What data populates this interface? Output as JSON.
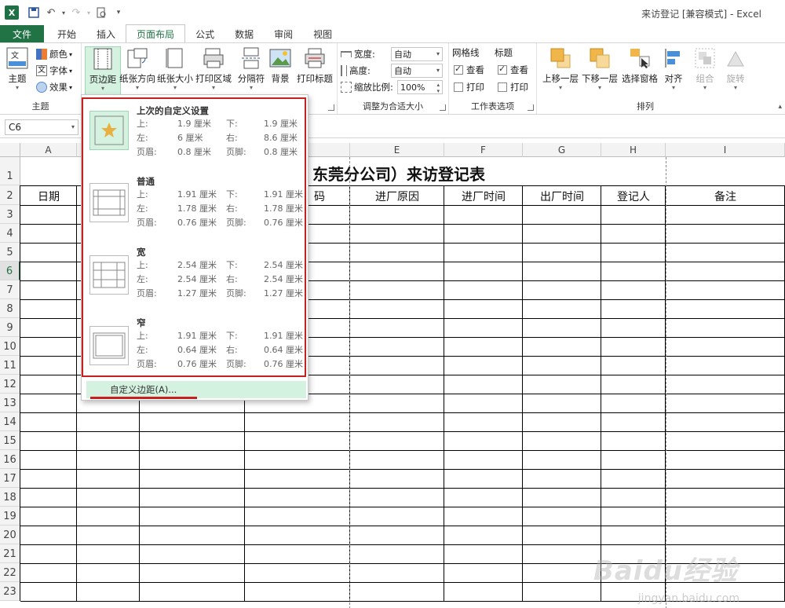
{
  "window": {
    "title": "来访登记  [兼容模式] - Excel"
  },
  "tabs": [
    {
      "label": "文件"
    },
    {
      "label": "开始"
    },
    {
      "label": "插入"
    },
    {
      "label": "页面布局"
    },
    {
      "label": "公式"
    },
    {
      "label": "数据"
    },
    {
      "label": "审阅"
    },
    {
      "label": "视图"
    }
  ],
  "ribbon": {
    "theme": {
      "main": "主题",
      "colors": "颜色",
      "fonts": "字体",
      "effects": "效果",
      "group": "主题"
    },
    "pagesetup": {
      "margins": "页边距",
      "orientation": "纸张方向",
      "size": "纸张大小",
      "print_area": "打印区域",
      "breaks": "分隔符",
      "background": "背景",
      "print_titles": "打印标题"
    },
    "scale": {
      "width_label": "宽度:",
      "width_value": "自动",
      "height_label": "高度:",
      "height_value": "自动",
      "scale_label": "缩放比例:",
      "scale_value": "100%",
      "group": "调整为合适大小"
    },
    "sheet_options": {
      "gridlines": "网格线",
      "headings": "标题",
      "view1": "查看",
      "print1": "打印",
      "view2": "查看",
      "print2": "打印",
      "group": "工作表选项"
    },
    "arrange": {
      "forward": "上移一层",
      "backward": "下移一层",
      "selection": "选择窗格",
      "align": "对齐",
      "group_btn": "组合",
      "rotate": "旋转",
      "group": "排列"
    }
  },
  "namebox": {
    "value": "C6"
  },
  "columns": [
    "A",
    "B",
    "C",
    "D",
    "E",
    "F",
    "G",
    "H",
    "I"
  ],
  "rows": [
    "1",
    "2",
    "3",
    "4",
    "5",
    "6",
    "7",
    "8",
    "9",
    "10",
    "11",
    "12",
    "13",
    "14",
    "15",
    "16",
    "17",
    "18",
    "19",
    "20",
    "21",
    "22",
    "23"
  ],
  "sheet": {
    "title_fragment": "东莞分公司）来访登记表",
    "headers": {
      "a": "日期",
      "d_tail": "码",
      "e": "进厂原因",
      "f": "进厂时间",
      "g": "出厂时间",
      "h": "登记人",
      "i": "备注"
    }
  },
  "margins_menu": {
    "options": [
      {
        "name": "上次的自定义设置",
        "top_l": "上:",
        "top_v": "1.9 厘米",
        "bottom_l": "下:",
        "bottom_v": "1.9 厘米",
        "left_l": "左:",
        "left_v": "6 厘米",
        "right_l": "右:",
        "right_v": "8.6 厘米",
        "header_l": "页眉:",
        "header_v": "0.8 厘米",
        "footer_l": "页脚:",
        "footer_v": "0.8 厘米"
      },
      {
        "name": "普通",
        "top_l": "上:",
        "top_v": "1.91 厘米",
        "bottom_l": "下:",
        "bottom_v": "1.91 厘米",
        "left_l": "左:",
        "left_v": "1.78 厘米",
        "right_l": "右:",
        "right_v": "1.78 厘米",
        "header_l": "页眉:",
        "header_v": "0.76 厘米",
        "footer_l": "页脚:",
        "footer_v": "0.76 厘米"
      },
      {
        "name": "宽",
        "top_l": "上:",
        "top_v": "2.54 厘米",
        "bottom_l": "下:",
        "bottom_v": "2.54 厘米",
        "left_l": "左:",
        "left_v": "2.54 厘米",
        "right_l": "右:",
        "right_v": "2.54 厘米",
        "header_l": "页眉:",
        "header_v": "1.27 厘米",
        "footer_l": "页脚:",
        "footer_v": "1.27 厘米"
      },
      {
        "name": "窄",
        "top_l": "上:",
        "top_v": "1.91 厘米",
        "bottom_l": "下:",
        "bottom_v": "1.91 厘米",
        "left_l": "左:",
        "left_v": "0.64 厘米",
        "right_l": "右:",
        "right_v": "0.64 厘米",
        "header_l": "页眉:",
        "header_v": "0.76 厘米",
        "footer_l": "页脚:",
        "footer_v": "0.76 厘米"
      }
    ],
    "custom": "自定义边距(A)..."
  },
  "watermark": {
    "main": "Baidu经验",
    "sub": "jingyan.baidu.com"
  },
  "colors": {
    "accent": "#217346",
    "highlight": "#c8201e"
  }
}
